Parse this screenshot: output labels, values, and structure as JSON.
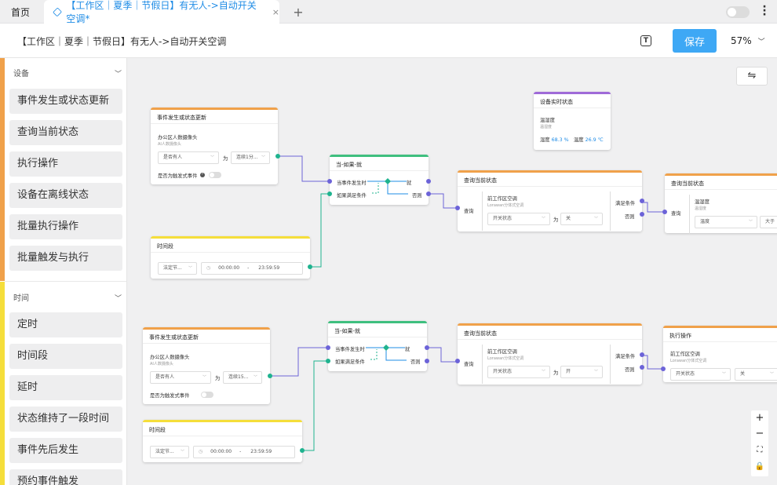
{
  "tabs": {
    "home": "首页",
    "active": "【工作区｜夏季｜节假日】有无人->自动开关空调*",
    "close": "×",
    "add": "+"
  },
  "header": {
    "title": "【工作区｜夏季｜节假日】有无人->自动开关空调",
    "text_icon": "T",
    "save": "保存",
    "zoom": "57%"
  },
  "sidebar": {
    "sections": [
      {
        "title": "设备",
        "color": "#f0a14a",
        "items": [
          "事件发生或状态更新",
          "查询当前状态",
          "执行操作",
          "设备在离线状态",
          "批量执行操作",
          "批量触发与执行"
        ]
      },
      {
        "title": "时间",
        "color": "#f5de3a",
        "items": [
          "定时",
          "时间段",
          "延时",
          "状态维持了一段时间",
          "事件先后发生",
          "预约事件触发"
        ]
      }
    ]
  },
  "canvas": {
    "swap_icon": "⇋",
    "zoom_controls": [
      "+",
      "−",
      "⛶",
      "🔒"
    ]
  },
  "flows": [
    {
      "event": {
        "title": "事件发生或状态更新",
        "device": "办公区人数摄像头",
        "device_sub": "AI人数摄像头",
        "attr": "是否有人",
        "op": "为",
        "value_a": "连续1分...",
        "value_b": "连续15...",
        "trigger_label": "是否为触发式事件"
      },
      "period": {
        "title": "时间段",
        "mode": "法定节...",
        "start": "00:00:00",
        "dash": "-",
        "end": "23:59:59"
      },
      "logic": {
        "title": "当-如果-就",
        "when": "当事件发生时",
        "if": "如果满足条件",
        "then": "就",
        "else": "否则"
      },
      "query": {
        "title": "查询当前状态",
        "in": "查询",
        "device": "前工作区空调",
        "device_sub": "Lorawan分体式空调",
        "attr": "开关状态",
        "op": "为",
        "value_a": "关",
        "value_b": "开",
        "ok": "满足条件",
        "else": "否则"
      }
    }
  ],
  "status_node": {
    "title": "设备实时状态",
    "device": "温湿度",
    "device_sub": "温湿度",
    "hum_label": "湿度",
    "hum_value": "68.3 %",
    "temp_label": "温度",
    "temp_value": "26.9 ℃"
  },
  "query2": {
    "title": "查询当前状态",
    "in": "查询",
    "device": "温湿度",
    "device_sub": "温湿度",
    "attr": "温度",
    "op": "大于"
  },
  "action": {
    "title": "执行操作",
    "device": "前工作区空调",
    "device_sub": "Lorawan分体式空调",
    "attr": "开关状态",
    "value": "关"
  }
}
